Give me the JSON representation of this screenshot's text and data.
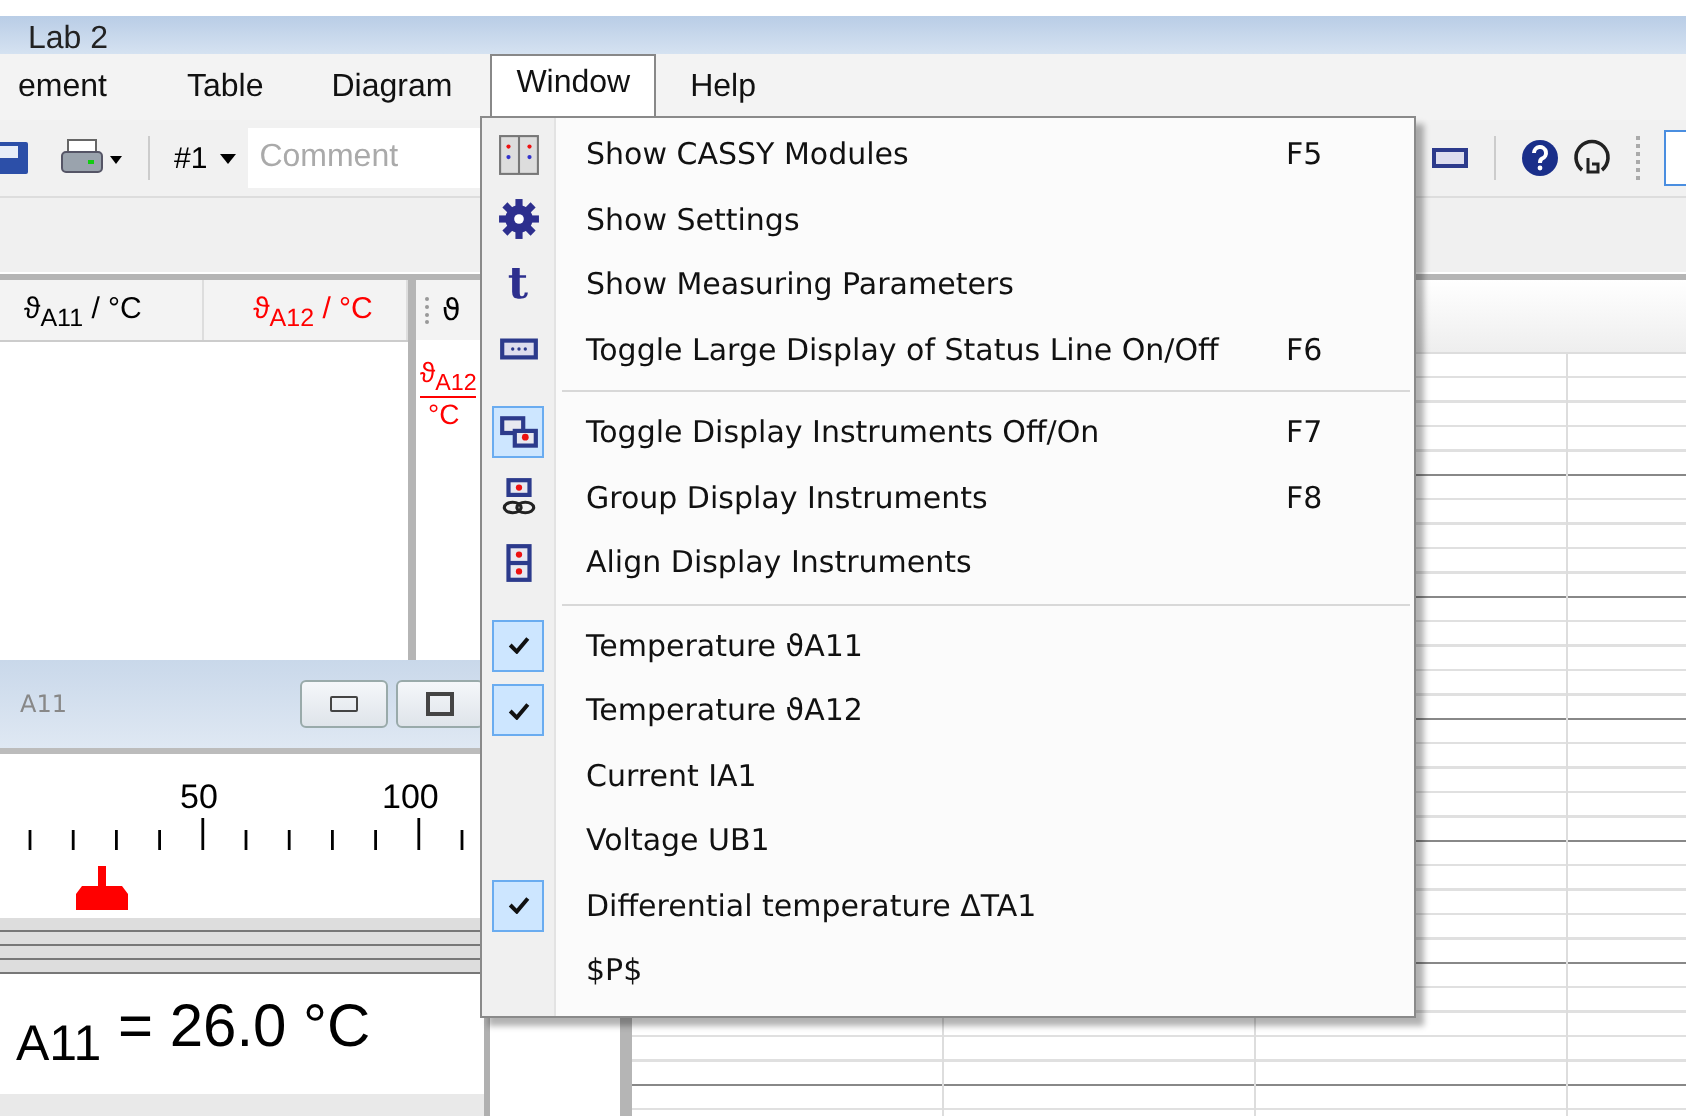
{
  "window": {
    "title": "Lab 2"
  },
  "menu_bar": [
    {
      "label": "ement",
      "selected": false
    },
    {
      "label": "Table",
      "selected": false
    },
    {
      "label": "Diagram",
      "selected": false
    },
    {
      "label": "Window",
      "selected": true
    },
    {
      "label": "Help",
      "selected": false
    }
  ],
  "toolbar": {
    "channel": "#1",
    "comment": {
      "placeholder": "Comment"
    }
  },
  "table_window": {
    "columns": [
      {
        "label": "ϑ$_{A11}$ / °C",
        "color": "#000000"
      },
      {
        "label": "ϑ$_{A12}$ / °C",
        "color": "#ff0000"
      }
    ]
  },
  "second_window": {
    "header": "ϑ",
    "column": {
      "label": "ϑ$_{A12}$",
      "unit": "°C",
      "color": "#ff0000"
    }
  },
  "instrument": {
    "title": "A11",
    "scale_labels": [
      "50",
      "100"
    ],
    "reading": "$_{A11}$ = 26.0 °C"
  },
  "dropdown": [
    {
      "kind": "command",
      "label": "Show CASSY Modules",
      "shortcut": "F5"
    },
    {
      "kind": "command",
      "label": "Show Settings"
    },
    {
      "kind": "command",
      "icon_text": "t",
      "label": "Show Measuring Parameters"
    },
    {
      "kind": "command",
      "label": "Toggle Large Display of Status Line On/Off",
      "shortcut": "F6"
    },
    {
      "kind": "separator"
    },
    {
      "kind": "toggle",
      "label": "Toggle Display Instruments Off/On",
      "shortcut": "F7",
      "checked": true
    },
    {
      "kind": "command",
      "label": "Group Display Instruments",
      "shortcut": "F8"
    },
    {
      "kind": "command",
      "label": "Align Display Instruments"
    },
    {
      "kind": "separator"
    },
    {
      "kind": "check",
      "label": "Temperature ϑA11",
      "checked": true
    },
    {
      "kind": "check",
      "label": "Temperature ϑA12",
      "checked": true
    },
    {
      "kind": "check",
      "label": "Current IA1",
      "checked": false
    },
    {
      "kind": "check",
      "label": "Voltage UB1",
      "checked": false
    },
    {
      "kind": "check",
      "label": "Differential temperature ΔTA1",
      "checked": true
    },
    {
      "kind": "check",
      "label": "$P$",
      "checked": false
    }
  ]
}
